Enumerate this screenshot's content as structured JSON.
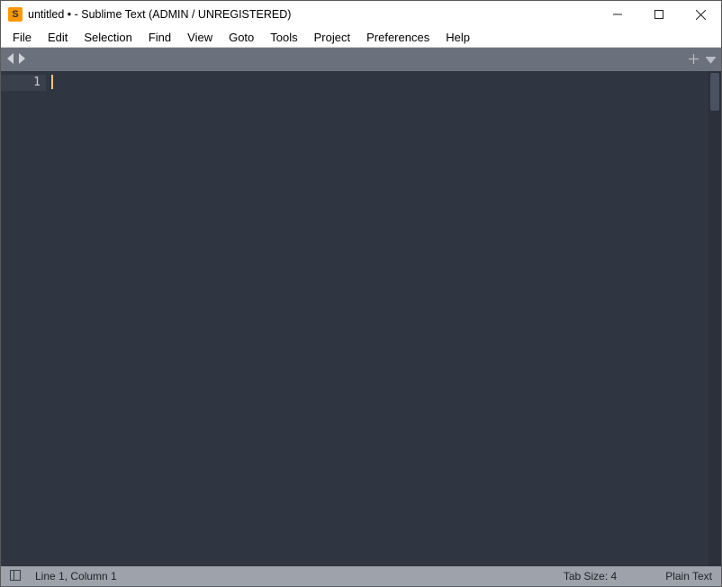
{
  "title": "untitled • - Sublime Text (ADMIN / UNREGISTERED)",
  "menu": [
    "File",
    "Edit",
    "Selection",
    "Find",
    "View",
    "Goto",
    "Tools",
    "Project",
    "Preferences",
    "Help"
  ],
  "gutter": {
    "line1": "1"
  },
  "status": {
    "position": "Line 1, Column 1",
    "tab_size": "Tab Size: 4",
    "syntax": "Plain Text"
  }
}
